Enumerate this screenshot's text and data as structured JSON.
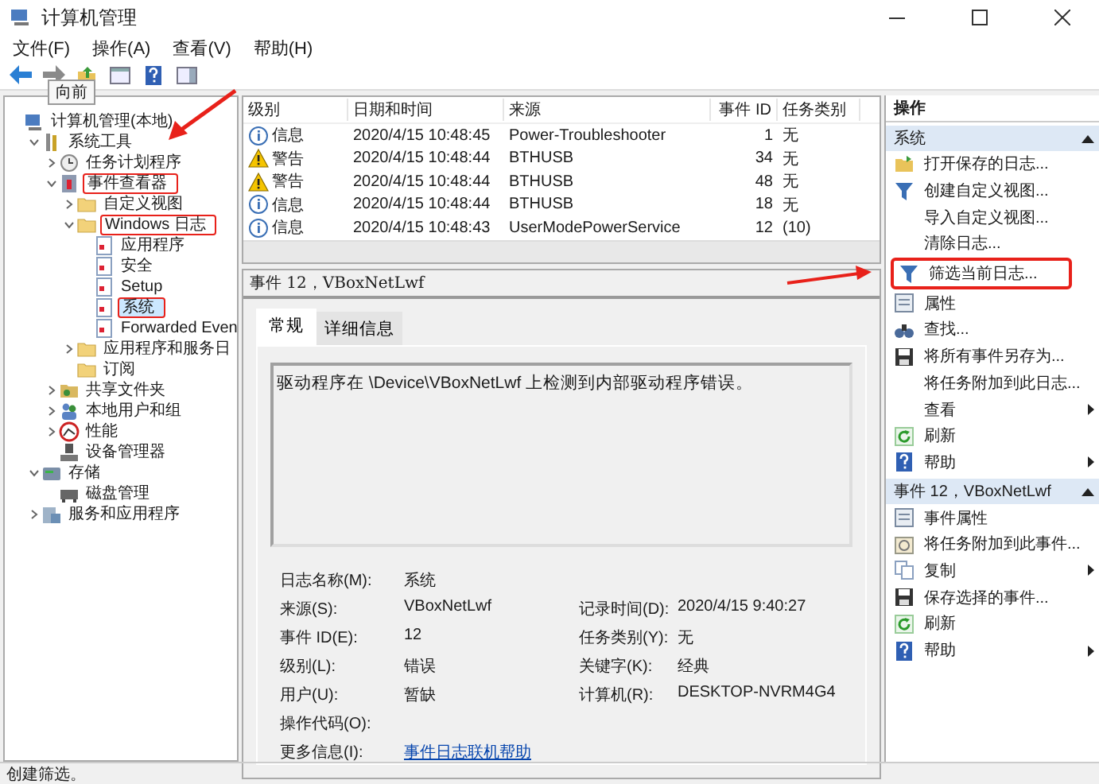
{
  "window": {
    "title": "计算机管理"
  },
  "menu": [
    "文件(F)",
    "操作(A)",
    "查看(V)",
    "帮助(H)"
  ],
  "tooltip": "向前",
  "tree": [
    {
      "label": "计算机管理(本地)",
      "kind": "computer",
      "selected": false,
      "children": [
        {
          "label": "系统工具",
          "kind": "tools",
          "expanded": true,
          "selected": false,
          "children": [
            {
              "label": "任务计划程序",
              "kind": "clock",
              "expanded": false,
              "selected": false
            },
            {
              "label": "事件查看器",
              "kind": "viewer",
              "expanded": true,
              "selected": false,
              "highlighted": true,
              "children": [
                {
                  "label": "自定义视图",
                  "kind": "folder",
                  "expanded": false,
                  "selected": false
                },
                {
                  "label": "Windows 日志",
                  "kind": "folder",
                  "expanded": true,
                  "selected": false,
                  "highlighted": true,
                  "children": [
                    {
                      "label": "应用程序",
                      "kind": "log",
                      "selected": false
                    },
                    {
                      "label": "安全",
                      "kind": "log",
                      "selected": false
                    },
                    {
                      "label": "Setup",
                      "kind": "log",
                      "selected": false
                    },
                    {
                      "label": "系统",
                      "kind": "log",
                      "selected": true,
                      "highlighted": true
                    },
                    {
                      "label": "Forwarded Even",
                      "kind": "log",
                      "selected": false
                    }
                  ]
                },
                {
                  "label": "应用程序和服务日",
                  "kind": "folder",
                  "expanded": false,
                  "selected": false
                },
                {
                  "label": "订阅",
                  "kind": "folder",
                  "selected": false
                }
              ]
            },
            {
              "label": "共享文件夹",
              "kind": "share",
              "expanded": false,
              "selected": false
            },
            {
              "label": "本地用户和组",
              "kind": "users",
              "expanded": false,
              "selected": false
            },
            {
              "label": "性能",
              "kind": "perf",
              "expanded": false,
              "selected": false
            },
            {
              "label": "设备管理器",
              "kind": "device",
              "selected": false
            }
          ]
        },
        {
          "label": "存储",
          "kind": "storage",
          "expanded": true,
          "selected": false,
          "children": [
            {
              "label": "磁盘管理",
              "kind": "disk",
              "selected": false
            }
          ]
        },
        {
          "label": "服务和应用程序",
          "kind": "services",
          "expanded": false,
          "selected": false
        }
      ]
    }
  ],
  "table": {
    "columns": [
      "级别",
      "日期和时间",
      "来源",
      "事件 ID",
      "任务类别"
    ],
    "rows": [
      {
        "kind": "info",
        "level": "信息",
        "time": "2020/4/15 10:48:45",
        "source": "Power-Troubleshooter",
        "id": "1",
        "category": "无"
      },
      {
        "kind": "warning",
        "level": "警告",
        "time": "2020/4/15 10:48:44",
        "source": "BTHUSB",
        "id": "34",
        "category": "无"
      },
      {
        "kind": "warning",
        "level": "警告",
        "time": "2020/4/15 10:48:44",
        "source": "BTHUSB",
        "id": "48",
        "category": "无"
      },
      {
        "kind": "info",
        "level": "信息",
        "time": "2020/4/15 10:48:44",
        "source": "BTHUSB",
        "id": "18",
        "category": "无"
      },
      {
        "kind": "info",
        "level": "信息",
        "time": "2020/4/15 10:48:43",
        "source": "UserModePowerService",
        "id": "12",
        "category": "(10)"
      }
    ]
  },
  "detail": {
    "title": "事件 12，VBoxNetLwf",
    "tabs": [
      {
        "label": "常规",
        "selected": true
      },
      {
        "label": "详细信息",
        "selected": false
      }
    ],
    "description": "驱动程序在 \\Device\\VBoxNetLwf 上检测到内部驱动程序错误。",
    "fields": [
      {
        "label": "日志名称(M):",
        "value": "系统"
      },
      {
        "label": "来源(S):",
        "value": "VBoxNetLwf",
        "label2": "记录时间(D):",
        "value2": "2020/4/15 9:40:27"
      },
      {
        "label": "事件 ID(E):",
        "value": "12",
        "label2": "任务类别(Y):",
        "value2": "无"
      },
      {
        "label": "级别(L):",
        "value": "错误",
        "label2": "关键字(K):",
        "value2": "经典"
      },
      {
        "label": "用户(U):",
        "value": "暂缺",
        "label2": "计算机(R):",
        "value2": "DESKTOP-NVRM4G4"
      },
      {
        "label": "操作代码(O):"
      },
      {
        "label": "更多信息(I):",
        "link": "事件日志联机帮助"
      }
    ]
  },
  "actions": {
    "title": "操作",
    "sections": [
      {
        "title": "系统",
        "expanded": true,
        "items": [
          {
            "label": "打开保存的日志...",
            "kind": "open"
          },
          {
            "label": "创建自定义视图...",
            "kind": "filter"
          },
          {
            "label": "导入自定义视图...",
            "kind": "none"
          },
          {
            "label": "清除日志...",
            "kind": "none"
          },
          {
            "label": "筛选当前日志...",
            "kind": "filter",
            "highlighted": true
          },
          {
            "label": "属性",
            "kind": "props"
          },
          {
            "label": "查找...",
            "kind": "find"
          },
          {
            "label": "将所有事件另存为...",
            "kind": "save"
          },
          {
            "label": "将任务附加到此日志...",
            "kind": "none"
          },
          {
            "label": "查看",
            "kind": "none",
            "submenu": true
          },
          {
            "label": "刷新",
            "kind": "refresh"
          },
          {
            "label": "帮助",
            "kind": "help",
            "submenu": true
          }
        ]
      },
      {
        "title": "事件 12，VBoxNetLwf",
        "expanded": true,
        "items": [
          {
            "label": "事件属性",
            "kind": "props"
          },
          {
            "label": "将任务附加到此事件...",
            "kind": "task"
          },
          {
            "label": "复制",
            "kind": "copy",
            "submenu": true
          },
          {
            "label": "保存选择的事件...",
            "kind": "save"
          },
          {
            "label": "刷新",
            "kind": "refresh"
          },
          {
            "label": "帮助",
            "kind": "help",
            "submenu": true
          }
        ]
      }
    ]
  },
  "status": "创建筛选。"
}
